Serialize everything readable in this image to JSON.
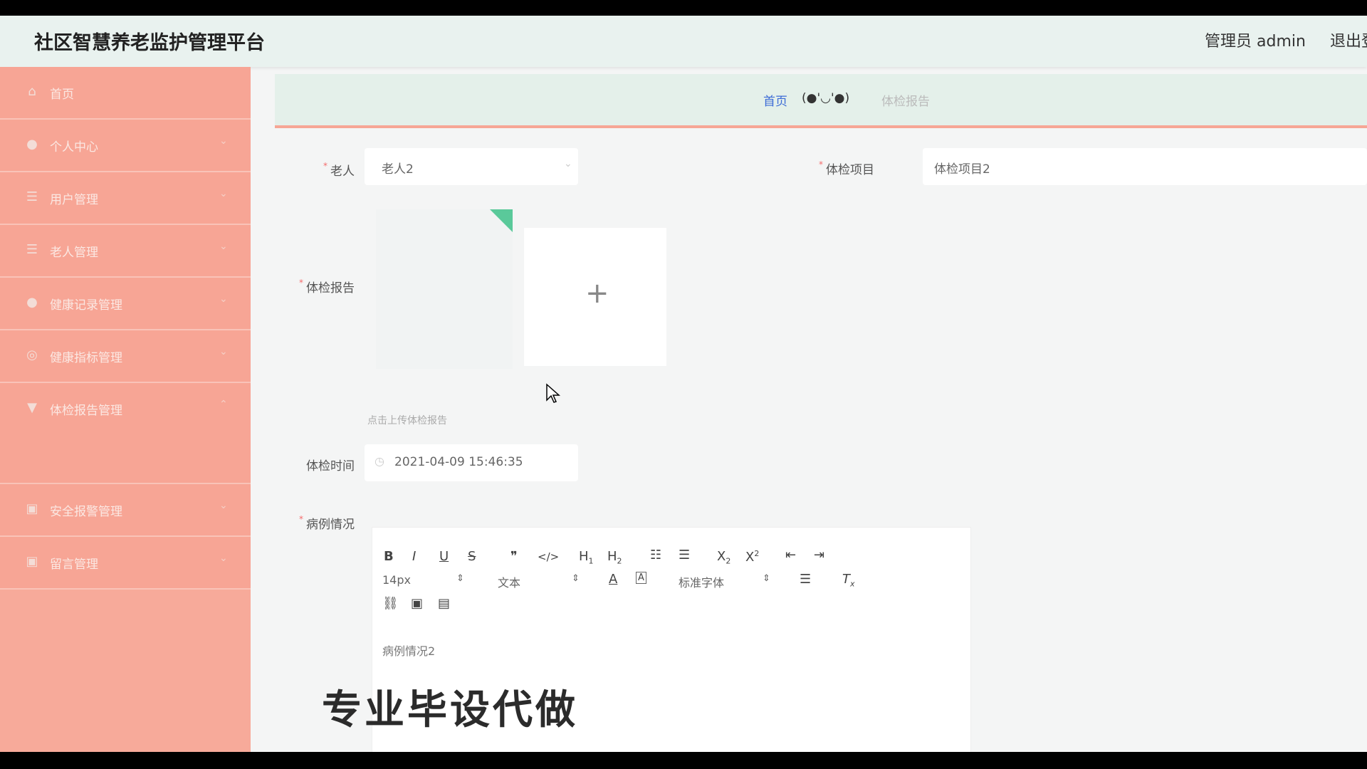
{
  "header": {
    "app_title": "社区智慧养老监护管理平台",
    "admin_label": "管理员 admin",
    "logout_label": "退出登录"
  },
  "sidebar": {
    "items": [
      {
        "label": "首页",
        "icon": "home-icon"
      },
      {
        "label": "个人中心",
        "icon": "user-icon"
      },
      {
        "label": "用户管理",
        "icon": "list-icon"
      },
      {
        "label": "老人管理",
        "icon": "list-icon"
      },
      {
        "label": "健康记录管理",
        "icon": "user-icon"
      },
      {
        "label": "健康指标管理",
        "icon": "circle-icon"
      },
      {
        "label": "体检报告管理",
        "icon": "pin-icon"
      },
      {
        "label": "安全报警管理",
        "icon": "box-icon"
      },
      {
        "label": "留言管理",
        "icon": "box-icon"
      }
    ],
    "active_sub_color": "#f2c56a"
  },
  "breadcrumb": {
    "home": "首页",
    "face": "(●'◡'●)",
    "current": "体检报告"
  },
  "form": {
    "elder_label": "老人",
    "elder_value": "老人2",
    "project_label": "体检项目",
    "project_value": "体检项目2",
    "report_label": "体检报告",
    "upload_tip": "点击上传体检报告",
    "time_label": "体检时间",
    "time_value": "2021-04-09 15:46:35",
    "case_label": "病例情况"
  },
  "editor": {
    "font_size": "14px",
    "text_type": "文本",
    "font_family": "标准字体",
    "content": "病例情况2"
  },
  "watermark": "专业毕设代做",
  "colors": {
    "sidebar": "#f7aa9a",
    "topbar": "#e9f2ef",
    "accent_line": "#f6a695",
    "link": "#3c6bd6"
  }
}
